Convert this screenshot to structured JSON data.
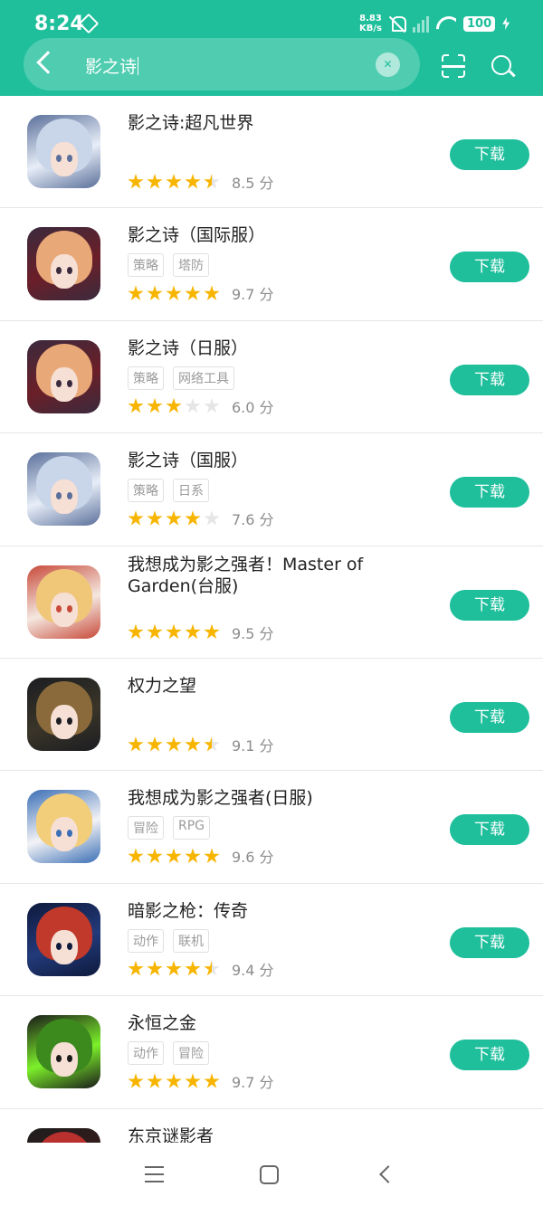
{
  "status_bar": {
    "time": "8:24",
    "speed_value": "8.83",
    "speed_unit": "KB/s",
    "battery": "100"
  },
  "search": {
    "query": "影之诗"
  },
  "icons": {
    "back": "back-arrow-icon",
    "clear": "clear-icon",
    "scan": "scan-icon",
    "search": "search-icon"
  },
  "colors": {
    "accent": "#1fbf9c",
    "star": "#f7b500"
  },
  "results": [
    {
      "name": "影之诗:超凡世界",
      "tags": [],
      "rating": 4.5,
      "score": "8.5 分",
      "button": "下载",
      "palette": [
        "#c9d6ea",
        "#e8eef8",
        "#5a6f9a"
      ]
    },
    {
      "name": "影之诗（国际服）",
      "tags": [
        "策略",
        "塔防"
      ],
      "rating": 5,
      "score": "9.7 分",
      "button": "下载",
      "palette": [
        "#e9a877",
        "#6b1f28",
        "#3a2a3d"
      ]
    },
    {
      "name": "影之诗（日服）",
      "tags": [
        "策略",
        "网络工具"
      ],
      "rating": 3,
      "score": "6.0 分",
      "button": "下载",
      "palette": [
        "#e9a877",
        "#6b1f28",
        "#3a2a3d"
      ]
    },
    {
      "name": "影之诗（国服）",
      "tags": [
        "策略",
        "日系"
      ],
      "rating": 4,
      "score": "7.6 分",
      "button": "下载",
      "palette": [
        "#c9d6ea",
        "#e8eef8",
        "#5a6f9a"
      ]
    },
    {
      "name": "我想成为影之强者！Master of Garden(台服)",
      "tags": [],
      "rating": 5,
      "score": "9.5 分",
      "button": "下载",
      "palette": [
        "#f0c679",
        "#f4e8e0",
        "#c84a3a"
      ]
    },
    {
      "name": "权力之望",
      "tags": [],
      "rating": 4.5,
      "score": "9.1 分",
      "button": "下载",
      "palette": [
        "#8a6a3a",
        "#3a3528",
        "#1c1d22"
      ]
    },
    {
      "name": "我想成为影之强者(日服)",
      "tags": [
        "冒险",
        "RPG"
      ],
      "rating": 5,
      "score": "9.6 分",
      "button": "下载",
      "palette": [
        "#f2cd7a",
        "#f3f3f6",
        "#3b6fb5"
      ]
    },
    {
      "name": "暗影之枪：传奇",
      "tags": [
        "动作",
        "联机"
      ],
      "rating": 4.5,
      "score": "9.4 分",
      "button": "下载",
      "palette": [
        "#c0392b",
        "#233a7a",
        "#0e1a3c"
      ]
    },
    {
      "name": "永恒之金",
      "tags": [
        "动作",
        "冒险"
      ],
      "rating": 5,
      "score": "9.7 分",
      "button": "下载",
      "palette": [
        "#3c8a1e",
        "#7cf02a",
        "#1a1a1a"
      ]
    },
    {
      "name": "东京谜影者",
      "tags": [],
      "rating": 0,
      "score": "",
      "button": "",
      "palette": [
        "#b8312f",
        "#3a1a1a",
        "#1e1e1e"
      ]
    }
  ]
}
